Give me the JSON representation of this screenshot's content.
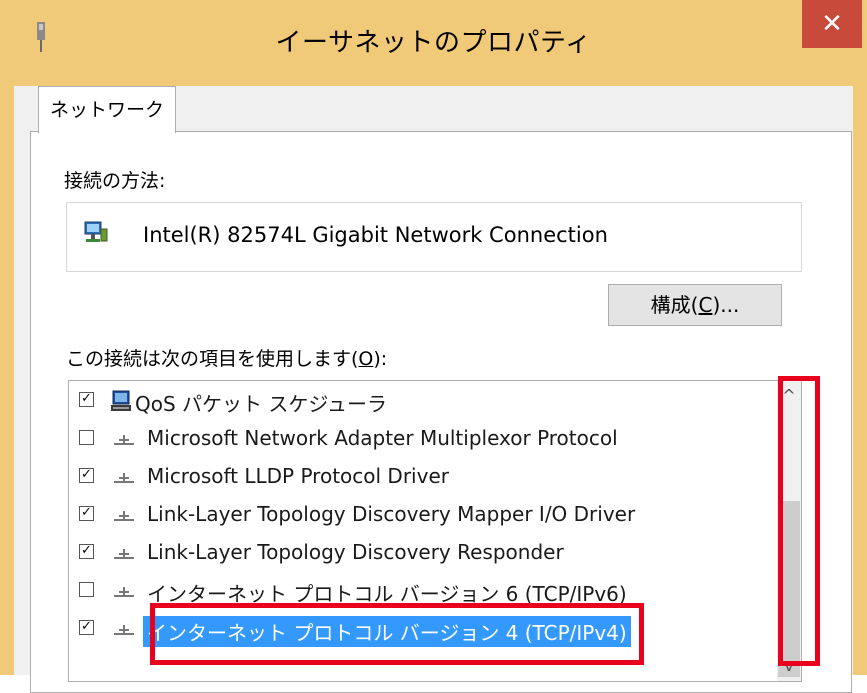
{
  "window": {
    "title": "イーサネットのプロパティ",
    "close_glyph": "✕",
    "icon": "network-adapter-icon"
  },
  "tabs": [
    {
      "label": "ネットワーク"
    }
  ],
  "connection": {
    "label": "接続の方法:",
    "adapter_name": "Intel(R) 82574L Gigabit Network Connection",
    "adapter_icon": "network-adapter-icon"
  },
  "configure_button": {
    "label_main": "構成(",
    "label_key": "C",
    "label_tail": ")..."
  },
  "items_label": {
    "main": "この接続は次の項目を使用します(",
    "key": "O",
    "tail": "):"
  },
  "items": [
    {
      "label": "QoS パケット スケジューラ",
      "checked": true,
      "checkmark": "✓",
      "icon": "computer-icon"
    },
    {
      "label": "Microsoft Network Adapter Multiplexor Protocol",
      "checked": false,
      "checkmark": "",
      "icon": "protocol-icon"
    },
    {
      "label": "Microsoft LLDP Protocol Driver",
      "checked": true,
      "checkmark": "✓",
      "icon": "protocol-icon"
    },
    {
      "label": "Link-Layer Topology Discovery Mapper I/O Driver",
      "checked": true,
      "checkmark": "✓",
      "icon": "protocol-icon"
    },
    {
      "label": "Link-Layer Topology Discovery Responder",
      "checked": true,
      "checkmark": "✓",
      "icon": "protocol-icon"
    },
    {
      "label": "インターネット プロトコル バージョン 6 (TCP/IPv6)",
      "checked": false,
      "checkmark": "",
      "icon": "protocol-icon"
    },
    {
      "label": "インターネット プロトコル バージョン 4 (TCP/IPv4)",
      "checked": true,
      "checkmark": "✓",
      "icon": "protocol-icon",
      "selected": true
    }
  ],
  "scrollbar": {
    "up_glyph": "^",
    "down_glyph": "v"
  },
  "colors": {
    "titlebar": "#f0ca78",
    "close": "#c74a3a",
    "selection": "#3399ff",
    "highlight": "#e8001c"
  }
}
